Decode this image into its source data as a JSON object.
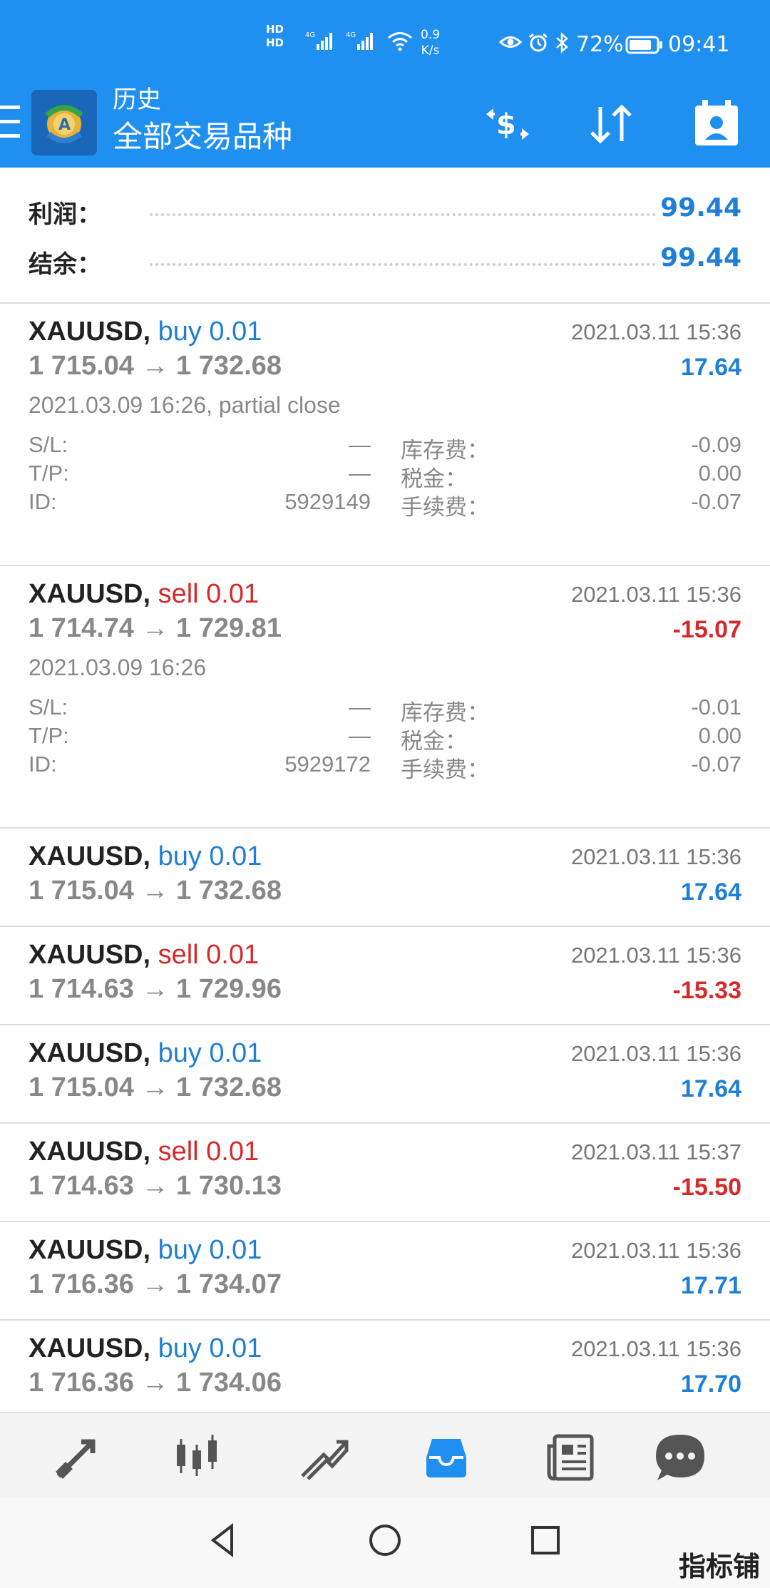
{
  "status_bar": {
    "hd1": "HD",
    "hd2": "HD",
    "net1": "4G",
    "net2": "4G",
    "speed_value": "0.9",
    "speed_unit": "K/s",
    "battery": "72%",
    "time": "09:41"
  },
  "app_bar": {
    "title": "历史",
    "subtitle": "全部交易品种",
    "icons": [
      "menu-icon",
      "app-logo",
      "quotes-icon",
      "sort-icon",
      "calendar-icon"
    ]
  },
  "summary": {
    "profit_label": "利润：",
    "profit_value": "99.44",
    "balance_label": "结余：",
    "balance_value": "99.44"
  },
  "detail_labels": {
    "sl": "S/L:",
    "tp": "T/P:",
    "id": "ID:",
    "swap": "库存费：",
    "tax": "税金：",
    "commission": "手续费："
  },
  "deals": [
    {
      "symbol": "XAUUSD,",
      "type": "buy 0.01",
      "side": "buy",
      "time": "2021.03.11 15:36",
      "prices": "1 715.04 → 1 732.68",
      "profit": "17.64",
      "expanded": true,
      "open_info": "2021.03.09 16:26, partial close",
      "sl": "—",
      "tp": "—",
      "id": "5929149",
      "swap": "-0.09",
      "tax": "0.00",
      "commission": "-0.07"
    },
    {
      "symbol": "XAUUSD,",
      "type": "sell 0.01",
      "side": "sell",
      "time": "2021.03.11 15:36",
      "prices": "1 714.74 → 1 729.81",
      "profit": "-15.07",
      "expanded": true,
      "open_info": "2021.03.09 16:26",
      "sl": "—",
      "tp": "—",
      "id": "5929172",
      "swap": "-0.01",
      "tax": "0.00",
      "commission": "-0.07"
    },
    {
      "symbol": "XAUUSD,",
      "type": "buy 0.01",
      "side": "buy",
      "time": "2021.03.11 15:36",
      "prices": "1 715.04 → 1 732.68",
      "profit": "17.64"
    },
    {
      "symbol": "XAUUSD,",
      "type": "sell 0.01",
      "side": "sell",
      "time": "2021.03.11 15:36",
      "prices": "1 714.63 → 1 729.96",
      "profit": "-15.33"
    },
    {
      "symbol": "XAUUSD,",
      "type": "buy 0.01",
      "side": "buy",
      "time": "2021.03.11 15:36",
      "prices": "1 715.04 → 1 732.68",
      "profit": "17.64"
    },
    {
      "symbol": "XAUUSD,",
      "type": "sell 0.01",
      "side": "sell",
      "time": "2021.03.11 15:37",
      "prices": "1 714.63 → 1 730.13",
      "profit": "-15.50"
    },
    {
      "symbol": "XAUUSD,",
      "type": "buy 0.01",
      "side": "buy",
      "time": "2021.03.11 15:36",
      "prices": "1 716.36 → 1 734.07",
      "profit": "17.71"
    },
    {
      "symbol": "XAUUSD,",
      "type": "buy 0.01",
      "side": "buy",
      "time": "2021.03.11 15:36",
      "prices": "1 716.36 → 1 734.06",
      "profit": "17.70"
    }
  ],
  "tab_bar": {
    "tabs": [
      "quotes-tab",
      "chart-tab",
      "trade-tab",
      "history-tab",
      "news-tab",
      "messages-tab"
    ],
    "active": "history-tab",
    "active_color": "#1f8ff0",
    "inactive_color": "#555555"
  },
  "nav_bar": {
    "buttons": [
      "back",
      "home",
      "recents"
    ]
  },
  "colors": {
    "header": "#1f8ff0",
    "positive": "#1f7fd6",
    "negative": "#d62a2a"
  },
  "watermark": "指标铺"
}
